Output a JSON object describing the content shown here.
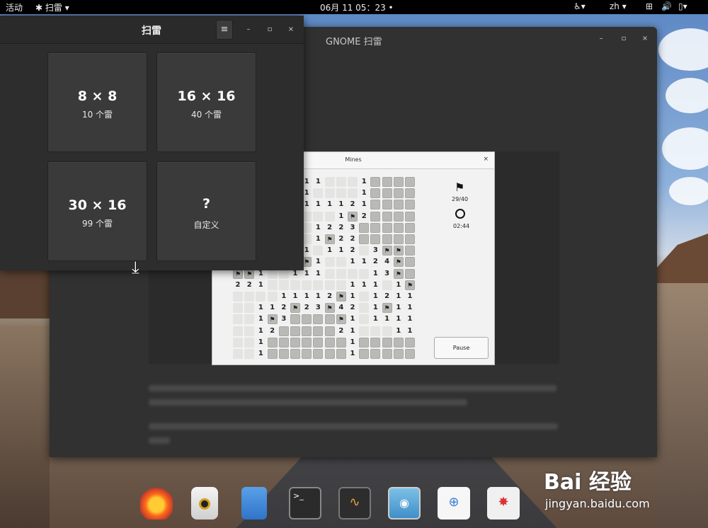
{
  "topbar": {
    "activities": "活动",
    "app_menu": "扫雷",
    "clock": "06月 11  05：23",
    "lang": "zh"
  },
  "bg_window": {
    "title": "GNOME 扫雷"
  },
  "mines_window": {
    "title": "Mines",
    "flags": "29/40",
    "time": "02:44",
    "pause": "Pause"
  },
  "main_window": {
    "title": "扫雷",
    "menu_icon": "≡",
    "minimize": "–",
    "maximize": "▫",
    "close": "×"
  },
  "tiles": [
    {
      "size": "8 × 8",
      "mines": "10 个雷"
    },
    {
      "size": "16 × 16",
      "mines": "40 个雷"
    },
    {
      "size": "30 × 16",
      "mines": "99 个雷"
    },
    {
      "size": "?",
      "mines": "自定义"
    }
  ],
  "grid": [
    "UUUUUUUUUUFo2o1o1oeeeeo1UU",
    "UUUUUUUUUUo2F1eeeeo1UU",
    "UUUUUUUUo1o1o1o1o1o2o1UU"
  ],
  "watermark": {
    "brand": "Bai 经验",
    "url": "jingyan.baidu.com"
  },
  "dock": [
    "firefox",
    "rhythmbox",
    "files",
    "terminal",
    "system-monitor",
    "screenshot",
    "software",
    "mines"
  ]
}
